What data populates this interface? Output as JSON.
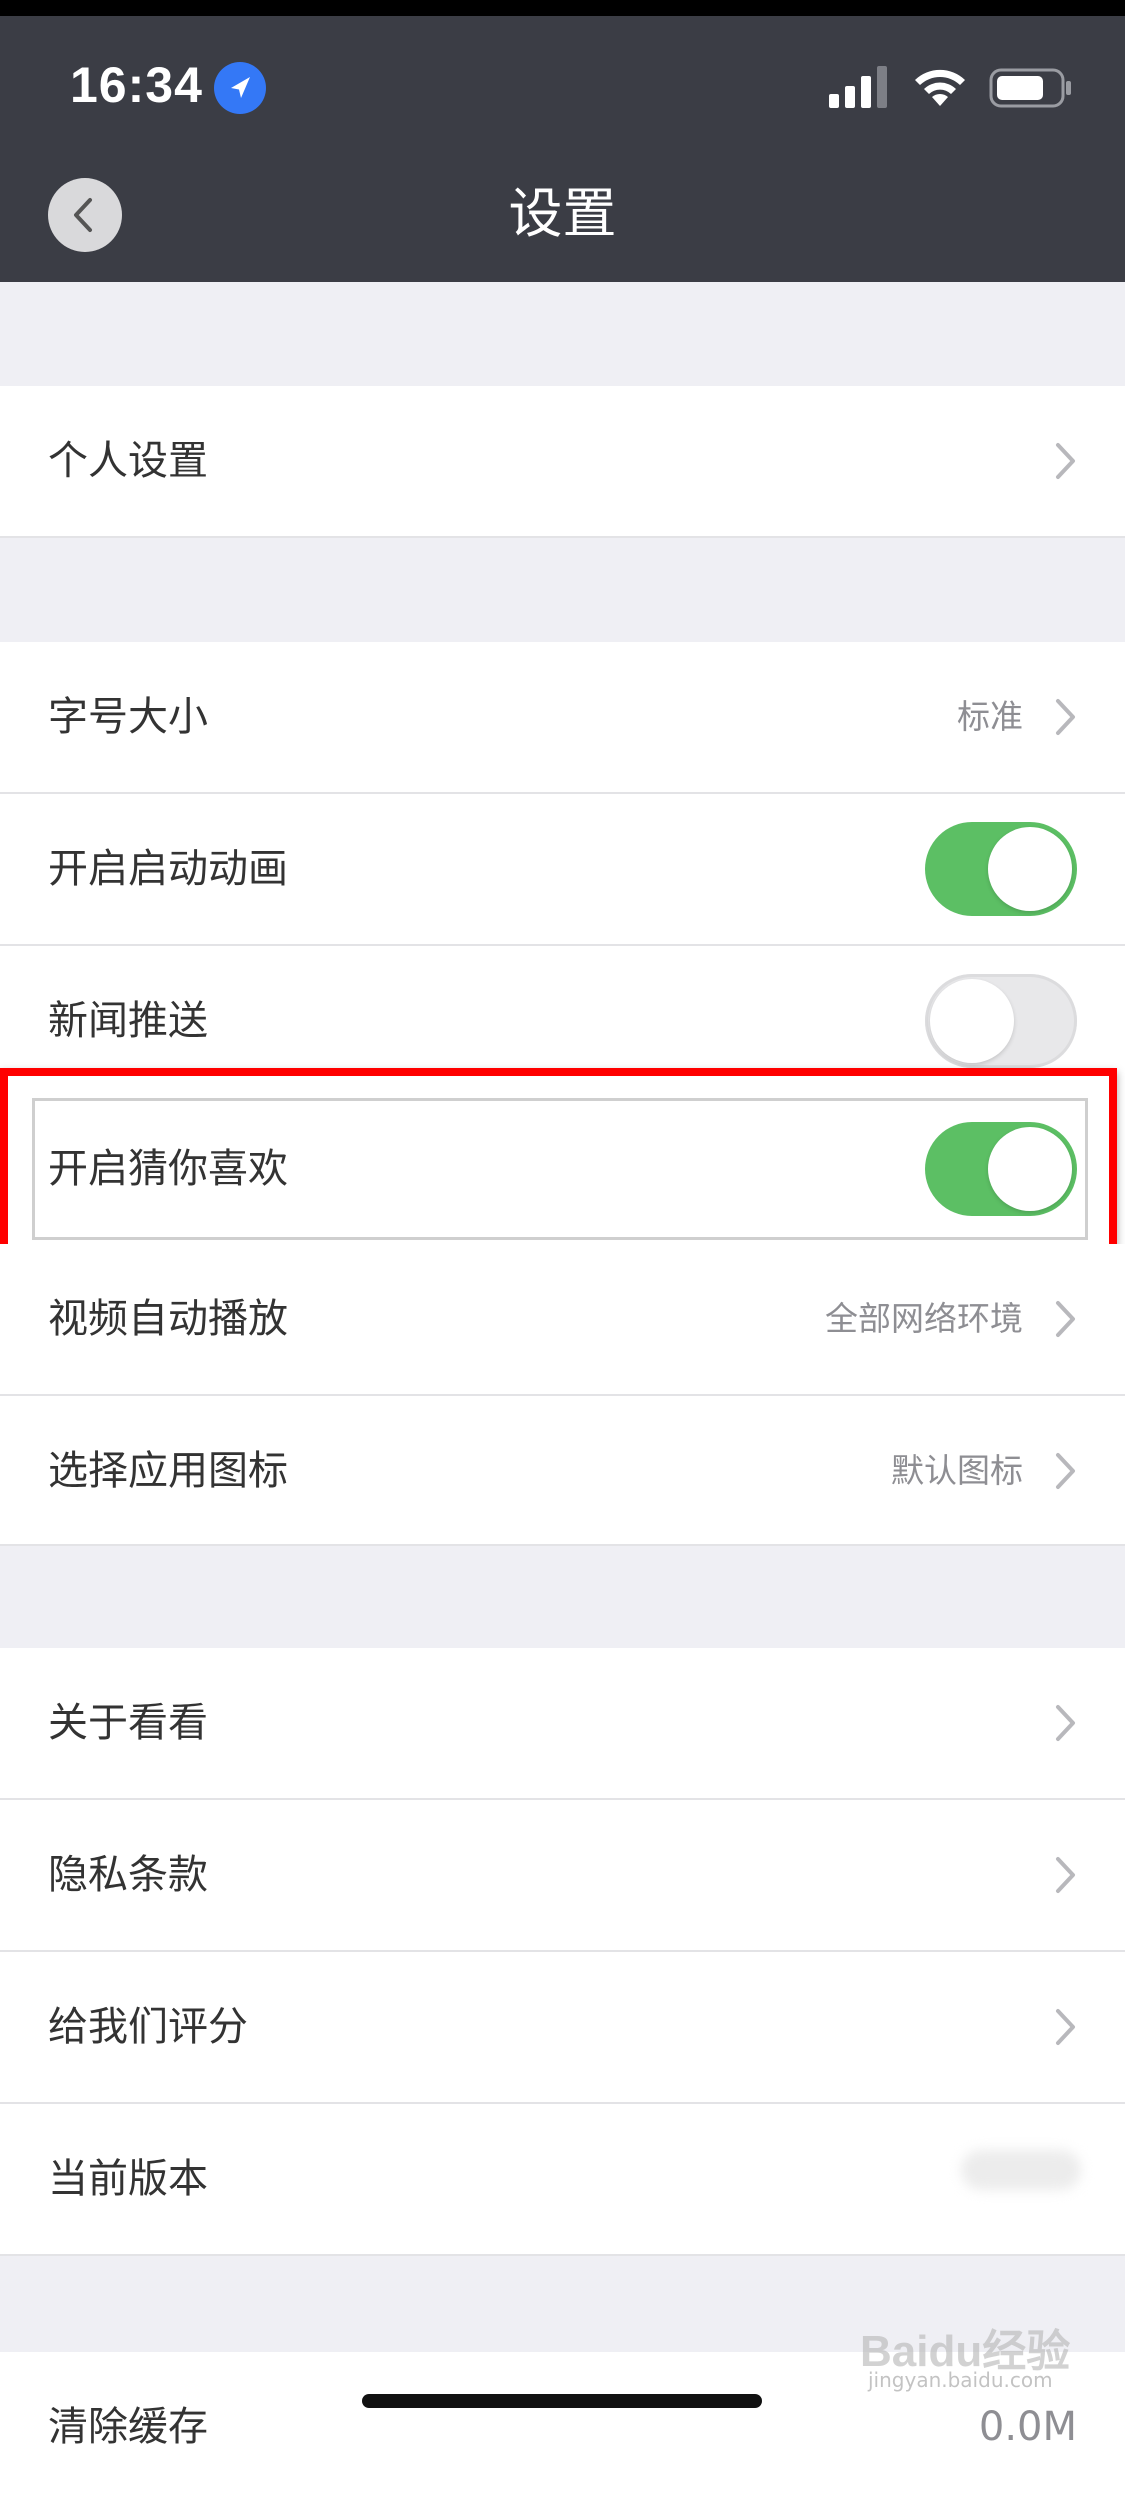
{
  "status_bar": {
    "time": "16:34"
  },
  "nav": {
    "title": "设置"
  },
  "sections": [
    {
      "rows": [
        {
          "label": "个人设置",
          "accessory": "chevron"
        }
      ]
    },
    {
      "rows": [
        {
          "label": "字号大小",
          "value": "标准",
          "accessory": "chevron"
        },
        {
          "label": "开启启动动画",
          "accessory": "toggle",
          "on": true
        },
        {
          "label": "新闻推送",
          "accessory": "toggle",
          "on": false
        },
        {
          "label": "开启猜你喜欢",
          "accessory": "toggle",
          "on": true,
          "highlighted": true
        },
        {
          "label": "视频自动播放",
          "value": "全部网络环境",
          "accessory": "chevron"
        },
        {
          "label": "选择应用图标",
          "value": "默认图标",
          "accessory": "chevron"
        }
      ]
    },
    {
      "rows": [
        {
          "label": "关于看看",
          "accessory": "chevron"
        },
        {
          "label": "隐私条款",
          "accessory": "chevron"
        },
        {
          "label": "给我们评分",
          "accessory": "chevron"
        },
        {
          "label": "当前版本",
          "value_blurred": true
        }
      ]
    },
    {
      "rows": [
        {
          "label": "清除缓存",
          "value": "0.0M"
        }
      ]
    }
  ],
  "colors": {
    "nav_bg": "#3b3d45",
    "toggle_on": "#5cbf64",
    "highlight": "#ff0000",
    "page_bg": "#efeff4"
  },
  "watermark": {
    "text": "Baidu经验",
    "sub": "jingyan.baidu.com"
  }
}
